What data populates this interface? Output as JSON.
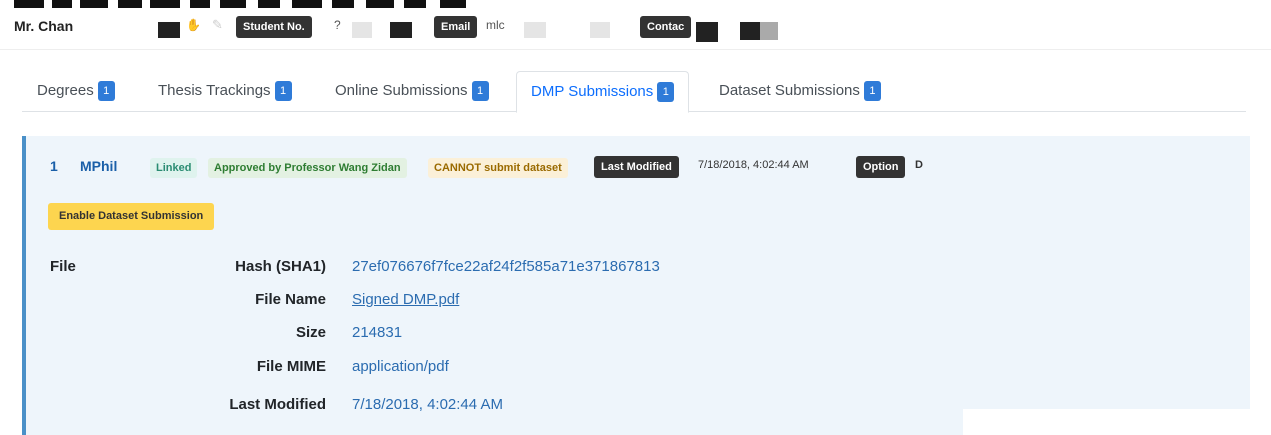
{
  "header": {
    "name": "Mr. Chan",
    "student_no_label": "Student No.",
    "student_no_value": "?",
    "email_label": "Email",
    "email_value": "mlc",
    "contact_label": "Contac",
    "icons": [
      "hand-icon",
      "edit-icon"
    ]
  },
  "tabs": [
    {
      "label": "Degrees",
      "count": "1",
      "active": false
    },
    {
      "label": "Thesis Trackings",
      "count": "1",
      "active": false
    },
    {
      "label": "Online Submissions",
      "count": "1",
      "active": false
    },
    {
      "label": "DMP Submissions",
      "count": "1",
      "active": true
    },
    {
      "label": "Dataset Submissions",
      "count": "1",
      "active": false
    }
  ],
  "record": {
    "index": "1",
    "degree": "MPhil",
    "linked": "Linked",
    "approved": "Approved by Professor Wang Zidan",
    "dataset_status": "CANNOT submit dataset",
    "last_modified_label": "Last Modified",
    "last_modified_value": "7/18/2018, 4:02:44 AM",
    "option_label": "Option",
    "option_value": "D",
    "enable_button": "Enable Dataset Submission",
    "file_section_label": "File",
    "file": {
      "hash_label": "Hash (SHA1)",
      "hash_value": "27ef076676f7fce22af24f2f585a71e371867813",
      "name_label": "File Name",
      "name_value": "Signed DMP.pdf",
      "size_label": "Size",
      "size_value": "214831",
      "mime_label": "File MIME",
      "mime_value": "application/pdf",
      "modified_label": "Last Modified",
      "modified_value": "7/18/2018, 4:02:44 AM"
    }
  },
  "colors": {
    "accent": "#2f7bd8",
    "card_bg": "#eef5fb",
    "card_border": "#4a90c8",
    "warning": "#fdd54f"
  }
}
